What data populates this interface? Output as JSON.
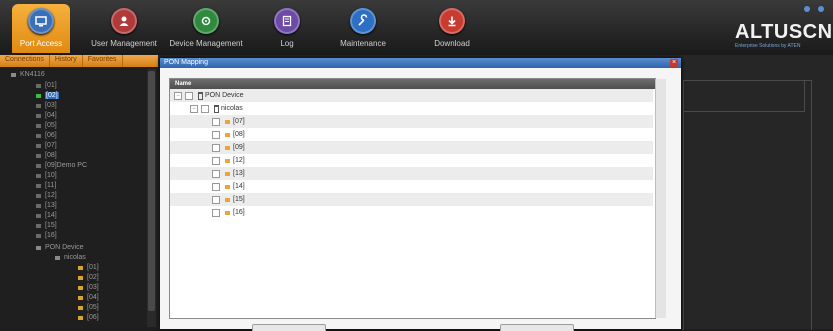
{
  "toolbar": {
    "items": [
      {
        "label": "Port Access",
        "icon": "monitor-icon",
        "color": "#3b6fb8"
      },
      {
        "label": "User Management",
        "icon": "users-icon",
        "color": "#b03a3a"
      },
      {
        "label": "Device Management",
        "icon": "device-icon",
        "color": "#2f8a3e"
      },
      {
        "label": "Log",
        "icon": "log-icon",
        "color": "#6b4aa8"
      },
      {
        "label": "Maintenance",
        "icon": "maintenance-icon",
        "color": "#2d6fc4"
      },
      {
        "label": "Download",
        "icon": "download-icon",
        "color": "#c83b30"
      }
    ],
    "active_index": 0
  },
  "brand": {
    "name": "ALTUSCN",
    "tagline": "Enterprise Solutions by ATEN"
  },
  "left_tabs": [
    "Connections",
    "History",
    "Favorites"
  ],
  "left_tree": {
    "root": "KN4116",
    "ports": [
      "[01]",
      "[02]",
      "[03]",
      "[04]",
      "[05]",
      "[06]",
      "[07]",
      "[08]",
      "[09]Demo PC",
      "[10]",
      "[11]",
      "[12]",
      "[13]",
      "[14]",
      "[15]",
      "[16]"
    ],
    "selected_port": "[02]",
    "pon_device": "PON Device",
    "pon_user": "nicolas",
    "pon_ports": [
      "[01]",
      "[02]",
      "[03]",
      "[04]",
      "[05]",
      "[06]"
    ]
  },
  "dialog": {
    "title": "PON Mapping",
    "close_glyph": "×",
    "column_header": "Name",
    "root": "PON Device",
    "user": "nicolas",
    "ports": [
      "[07]",
      "[08]",
      "[09]",
      "[12]",
      "[13]",
      "[14]",
      "[15]",
      "[16]"
    ],
    "expand_glyph": "−"
  },
  "colors": {
    "accent": "#e8961f",
    "title_bar": "#3a6fb8",
    "port_icon": "#e9a43a",
    "selected": "#2f6fc1"
  }
}
